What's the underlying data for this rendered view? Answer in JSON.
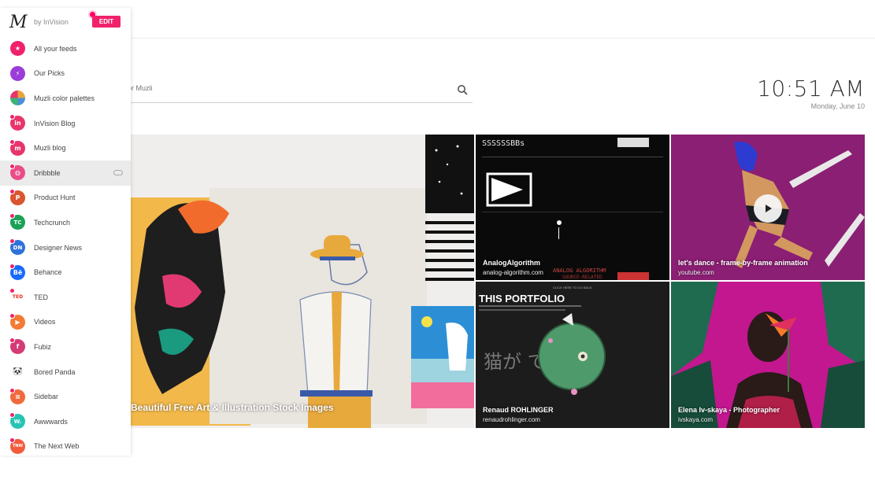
{
  "sidebar": {
    "by_label": "by InVision",
    "edit_label": "EDIT",
    "items": [
      {
        "label": "All your feeds",
        "icon": "star-icon",
        "color": "#f0226b",
        "glyph": "★"
      },
      {
        "label": "Our Picks",
        "icon": "bolt-icon",
        "color": "#9b3cd8",
        "glyph": "⚡"
      },
      {
        "label": "Muzli color palettes",
        "icon": "palette-icon",
        "color": "#e8a33d",
        "glyph": ""
      },
      {
        "label": "InVision Blog",
        "icon": "invision-icon",
        "color": "#e8356b",
        "glyph": "in"
      },
      {
        "label": "Muzli blog",
        "icon": "muzli-icon",
        "color": "#e8356b",
        "glyph": "m"
      },
      {
        "label": "Dribbble",
        "icon": "dribbble-icon",
        "color": "#ea4c89",
        "glyph": "◍"
      },
      {
        "label": "Product Hunt",
        "icon": "product-hunt-icon",
        "color": "#da552f",
        "glyph": "P"
      },
      {
        "label": "Techcrunch",
        "icon": "techcrunch-icon",
        "color": "#1aa157",
        "glyph": "TC"
      },
      {
        "label": "Designer News",
        "icon": "designer-news-icon",
        "color": "#2d72d9",
        "glyph": "DN"
      },
      {
        "label": "Behance",
        "icon": "behance-icon",
        "color": "#1769ff",
        "glyph": "Bē"
      },
      {
        "label": "TED",
        "icon": "ted-icon",
        "color": "#ffffff",
        "glyph": "TED"
      },
      {
        "label": "Videos",
        "icon": "play-icon",
        "color": "#f47b34",
        "glyph": "▶"
      },
      {
        "label": "Fubiz",
        "icon": "fubiz-icon",
        "color": "#d33a76",
        "glyph": "f"
      },
      {
        "label": "Bored Panda",
        "icon": "panda-icon",
        "color": "#ffffff",
        "glyph": "🐼"
      },
      {
        "label": "Sidebar",
        "icon": "sidebar-icon",
        "color": "#f06a3c",
        "glyph": "≡"
      },
      {
        "label": "Awwwards",
        "icon": "awwwards-icon",
        "color": "#27c4b4",
        "glyph": "W."
      },
      {
        "label": "The Next Web",
        "icon": "tnw-icon",
        "color": "#f25c3d",
        "glyph": "TNW"
      }
    ]
  },
  "search": {
    "placeholder": "or Muzli"
  },
  "clock": {
    "time": "10:51 AM",
    "date": "Monday, June 10"
  },
  "tiles": {
    "big": {
      "caption": "Beautiful Free Art & Illustration Stock Images"
    },
    "t1": {
      "caption": "AnalogAlgorithm",
      "source": "analog-algorithm.com",
      "header": "SSSSSSBBs",
      "overlay": "ANALOG ALGORITHM",
      "overlay2": "SOURCE-RELATED"
    },
    "t2": {
      "caption": "let's dance - frame-by-frame animation",
      "source": "youtube.com"
    },
    "t3": {
      "caption": "Renaud ROHLINGER",
      "source": "renaudrohlinger.com",
      "title": "THIS PORTFOLIO",
      "jp": "猫が です",
      "hint": "CLICK HERE TO GO BACK"
    },
    "t4": {
      "caption": "Elena Iv-skaya - Photographer",
      "source": "ivskaya.com"
    }
  },
  "colors": {
    "accent": "#f0226b"
  }
}
